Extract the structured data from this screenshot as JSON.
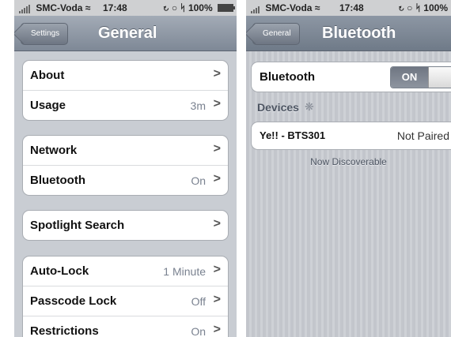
{
  "left_screen": {
    "status": {
      "carrier": "SMC-Voda",
      "time": "17:48",
      "battery": "100%"
    },
    "nav": {
      "back_label": "Settings",
      "title": "General"
    },
    "groups": [
      [
        {
          "label": "About",
          "value": ""
        },
        {
          "label": "Usage",
          "value": "3m"
        }
      ],
      [
        {
          "label": "Network",
          "value": ""
        },
        {
          "label": "Bluetooth",
          "value": "On"
        }
      ],
      [
        {
          "label": "Spotlight Search",
          "value": ""
        }
      ],
      [
        {
          "label": "Auto-Lock",
          "value": "1 Minute"
        },
        {
          "label": "Passcode Lock",
          "value": "Off"
        },
        {
          "label": "Restrictions",
          "value": "On"
        }
      ]
    ],
    "chevron": ">"
  },
  "right_screen": {
    "status": {
      "carrier": "SMC-Voda",
      "time": "17:48",
      "battery": "100%"
    },
    "nav": {
      "back_label": "General",
      "title": "Bluetooth"
    },
    "bluetooth_label": "Bluetooth",
    "toggle_label": "ON",
    "devices_header": "Devices",
    "device": {
      "name": "Ye!! - BTS301",
      "status": "Not Paired"
    },
    "discoverable_text": "Now Discoverable"
  },
  "colors": {
    "navbar": "#8d97a4",
    "background": "#c9cdd3"
  },
  "icons": [
    "signal-icon",
    "wifi-icon",
    "lock-rotation-icon",
    "alarm-icon",
    "bluetooth-icon",
    "battery-icon",
    "spinner-icon",
    "chevron-right-icon",
    "back-arrow-icon"
  ]
}
